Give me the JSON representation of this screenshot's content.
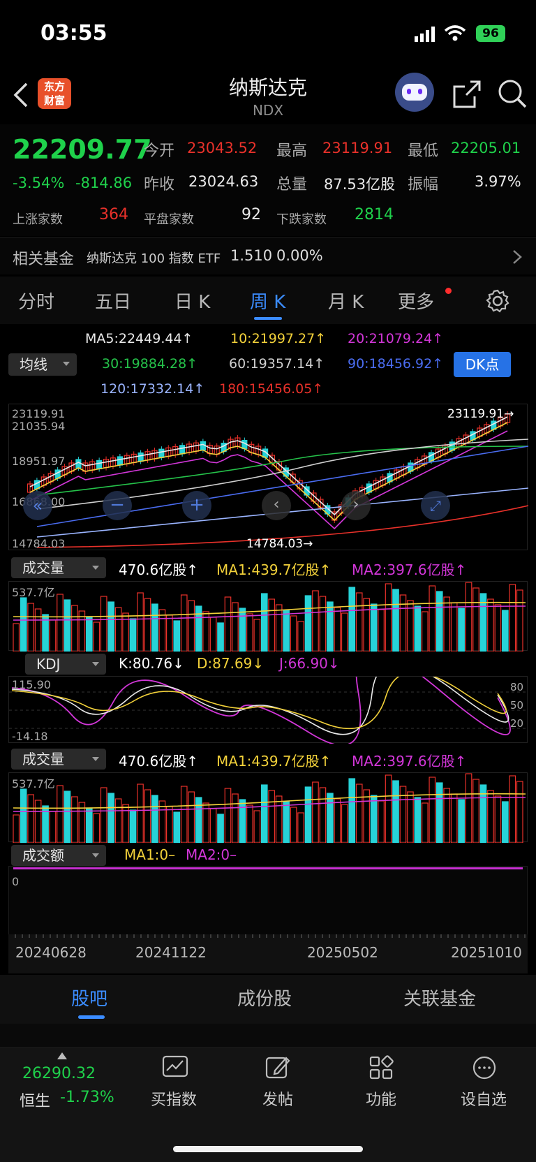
{
  "status_bar": {
    "time": "03:55",
    "battery": "96"
  },
  "header": {
    "title": "纳斯达克",
    "code": "NDX",
    "logo_text_1": "东方",
    "logo_text_2": "财富"
  },
  "quote": {
    "price": "22209.77",
    "change_pct": "-3.54%",
    "change_abs": "-814.86",
    "open_label": "今开",
    "open": "23043.52",
    "high_label": "最高",
    "high": "23119.91",
    "low_label": "最低",
    "low": "22205.01",
    "prev_close_label": "昨收",
    "prev_close": "23024.63",
    "volume_label": "总量",
    "volume": "87.53亿股",
    "amplitude_label": "振幅",
    "amplitude": "3.97%",
    "up_count_label": "上涨家数",
    "up_count": "364",
    "flat_count_label": "平盘家数",
    "flat_count": "92",
    "down_count_label": "下跌家数",
    "down_count": "2814"
  },
  "related_fund": {
    "label": "相关基金",
    "name": "纳斯达克 100 指数 ETF",
    "price": "1.510",
    "change": "0.00%"
  },
  "chart_tabs": [
    "分时",
    "五日",
    "日 K",
    "周 K",
    "月 K",
    "更多"
  ],
  "active_tab": "周 K",
  "ma_legend": {
    "selector": "均线",
    "ma5": "MA5:22449.44↑",
    "ma10": "10:21997.27↑",
    "ma20": "20:21079.24↑",
    "ma30": "30:19884.28↑",
    "ma60": "60:19357.14↑",
    "ma90": "90:18456.92↑",
    "ma120": "120:17332.14↑",
    "ma180": "180:15456.05↑",
    "dk_button": "DK点"
  },
  "price_axis": {
    "top": "23119.91",
    "l2": "21035.94",
    "l3": "18951.97",
    "l4": "16868.00",
    "bottom": "14784.03"
  },
  "price_markers": {
    "high": "23119.91",
    "low": "14784.03"
  },
  "volume_panel": {
    "selector": "成交量",
    "vol": "470.6亿股↑",
    "ma1": "MA1:439.7亿股↑",
    "ma2": "MA2:397.6亿股↑",
    "axis_top": "537.7亿"
  },
  "kdj_panel": {
    "selector": "KDJ",
    "k": "K:80.76↓",
    "d": "D:87.69↓",
    "j": "J:66.90↓",
    "axis_top": "115.90",
    "axis_bottom": "-14.18",
    "level_80": "80",
    "level_50": "50",
    "level_20": "20"
  },
  "volume_panel2": {
    "selector": "成交量",
    "vol": "470.6亿股↑",
    "ma1": "MA1:439.7亿股↑",
    "ma2": "MA2:397.6亿股↑",
    "axis_top": "537.7亿"
  },
  "amount_panel": {
    "selector": "成交额",
    "ma1": "MA1:0–",
    "ma2": "MA2:0–",
    "axis_zero": "0"
  },
  "dates": [
    "20240628",
    "20241122",
    "20250502",
    "20251010"
  ],
  "section_tabs": [
    "股吧",
    "成份股",
    "关联基金"
  ],
  "bottom_bar": {
    "index_value": "26290.32",
    "index_name": "恒生",
    "index_change": "-1.73%",
    "items": [
      "买指数",
      "发帖",
      "功能",
      "设自选"
    ]
  },
  "colors": {
    "up": "#e8312a",
    "down": "#1fd14b",
    "accent": "#2f7fff",
    "candle_down": "#27d3d8"
  }
}
